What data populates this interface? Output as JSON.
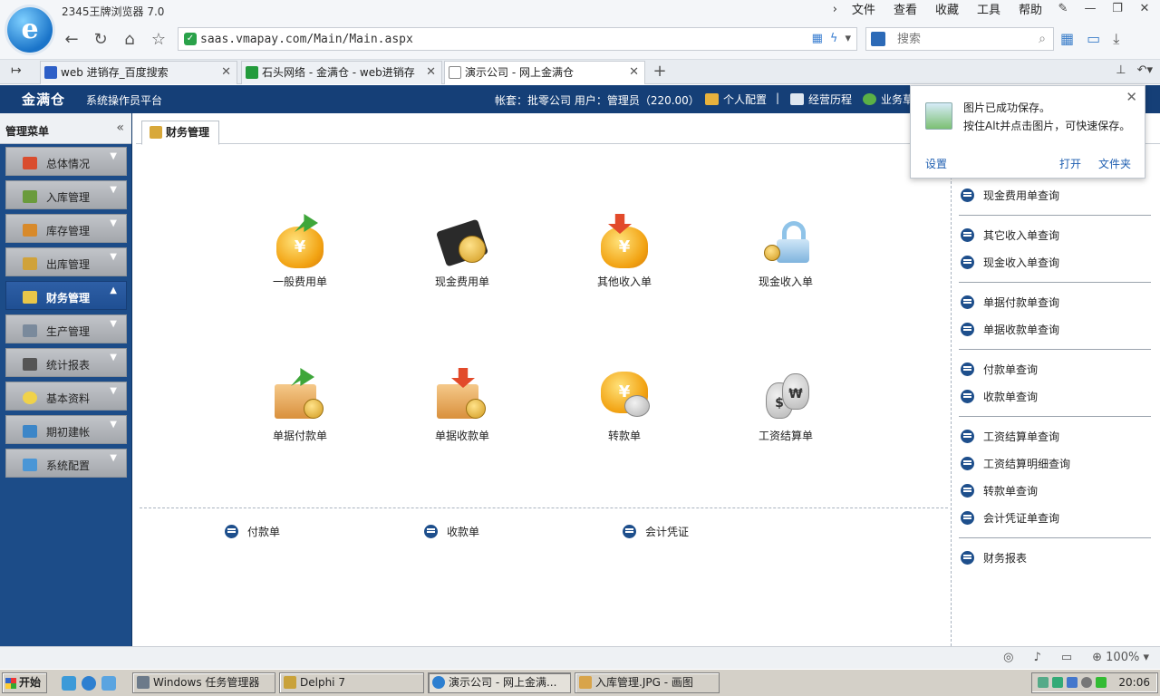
{
  "browser": {
    "title": "2345王牌浏览器 7.0",
    "menu": [
      "文件",
      "查看",
      "收藏",
      "工具",
      "帮助"
    ],
    "url": "saas.vmapay.com/Main/Main.aspx",
    "search_placeholder": "搜索",
    "tabs": [
      {
        "label": "web 进销存_百度搜索",
        "active": false
      },
      {
        "label": "石头网络 - 金满仓 - web进销存",
        "active": false
      },
      {
        "label": "演示公司 - 网上金满仓",
        "active": true
      }
    ],
    "zoom": "100%"
  },
  "app": {
    "logo": "金满仓",
    "subtitle": "系统操作员平台",
    "account": "帐套：批零公司 用户：管理员（220.00）",
    "links": [
      "个人配置",
      "经营历程",
      "业务草"
    ],
    "separator": "|"
  },
  "sidebar": {
    "title": "管理菜单",
    "items": [
      {
        "label": "总体情况",
        "active": false
      },
      {
        "label": "入库管理",
        "active": false
      },
      {
        "label": "库存管理",
        "active": false
      },
      {
        "label": "出库管理",
        "active": false
      },
      {
        "label": "财务管理",
        "active": true
      },
      {
        "label": "生产管理",
        "active": false
      },
      {
        "label": "统计报表",
        "active": false
      },
      {
        "label": "基本资料",
        "active": false
      },
      {
        "label": "期初建帐",
        "active": false
      },
      {
        "label": "系统配置",
        "active": false
      }
    ]
  },
  "content_tab": "财务管理",
  "main": {
    "functions": [
      {
        "label": "一般费用单",
        "icon": "money-bag-arrow-up-icon"
      },
      {
        "label": "现金费用单",
        "icon": "wallet-coin-icon"
      },
      {
        "label": "其他收入单",
        "icon": "money-bag-arrow-down-icon"
      },
      {
        "label": "现金收入单",
        "icon": "lock-cash-icon"
      },
      {
        "label": "单据付款单",
        "icon": "folder-arrow-up-icon"
      },
      {
        "label": "单据收款单",
        "icon": "folder-arrow-down-icon"
      },
      {
        "label": "转款单",
        "icon": "money-bag-coins-icon"
      },
      {
        "label": "工资结算单",
        "icon": "money-sacks-icon"
      }
    ],
    "links": [
      "付款单",
      "收款单",
      "会计凭证"
    ]
  },
  "right_panel": {
    "groups": [
      [
        "现金费用单查询"
      ],
      [
        "其它收入单查询",
        "现金收入单查询"
      ],
      [
        "单据付款单查询",
        "单据收款单查询"
      ],
      [
        "付款单查询",
        "收款单查询"
      ],
      [
        "工资结算单查询",
        "工资结算明细查询",
        "转款单查询",
        "会计凭证单查询"
      ],
      [
        "财务报表"
      ]
    ]
  },
  "popup": {
    "line1": "图片已成功保存。",
    "line2": "按住Alt并点击图片，可快速保存。",
    "settings": "设置",
    "open": "打开",
    "folder": "文件夹"
  },
  "taskbar": {
    "start": "开始",
    "tasks": [
      {
        "label": "Windows 任务管理器",
        "active": false
      },
      {
        "label": "Delphi 7",
        "active": false
      },
      {
        "label": "演示公司 - 网上金满...",
        "active": true
      },
      {
        "label": "入库管理.JPG - 画图",
        "active": false
      }
    ],
    "clock": "20:06"
  },
  "colors": {
    "header_bg": "#153f77",
    "sidebar_bg": "#1c4c88",
    "bullet": "#1e4f8c",
    "link_blue": "#1f5fb1"
  }
}
